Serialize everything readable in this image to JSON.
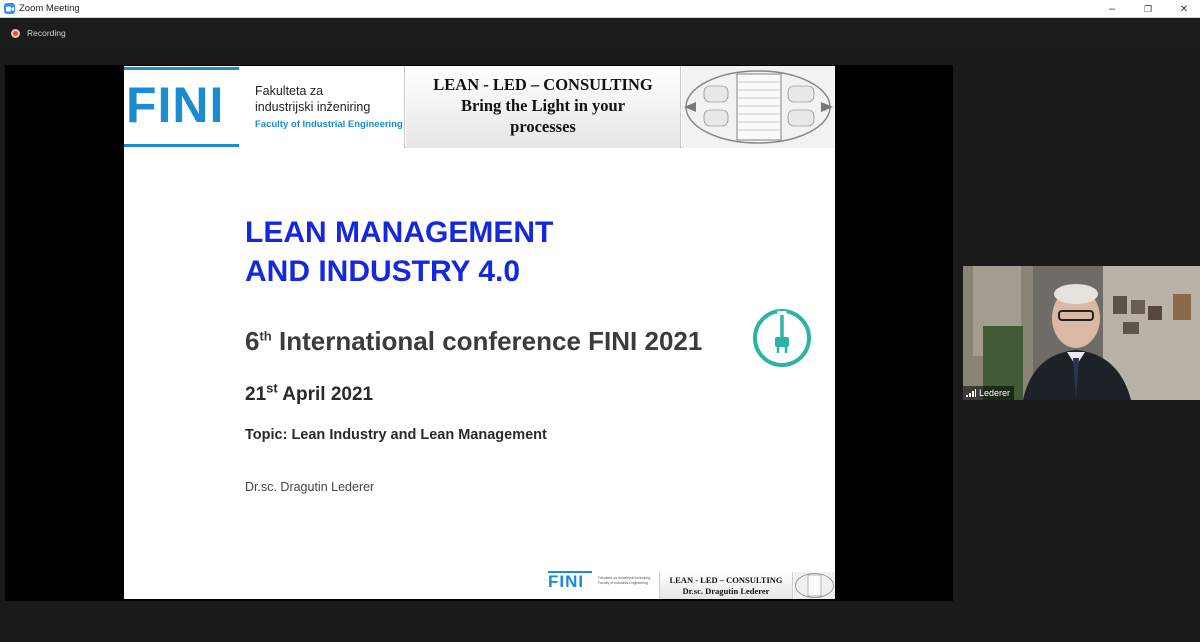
{
  "window": {
    "title": "Zoom Meeting",
    "minimize_glyph": "–",
    "maximize_glyph": "❐",
    "close_glyph": "✕"
  },
  "recording": {
    "label": "Recording"
  },
  "slide": {
    "header": {
      "logo": "FINI",
      "faculty_line1": "Fakulteta za",
      "faculty_line2": "industrijski inženiring",
      "faculty_line3": "Faculty of Industrial Engineering",
      "consult_line1": "LEAN - LED – CONSULTING",
      "consult_line2": "Bring the Light in your",
      "consult_line3": "processes"
    },
    "title_line1": "LEAN MANAGEMENT",
    "title_line2": "AND INDUSTRY 4.0",
    "conference_number": "6",
    "conference_sup": "th",
    "conference_text": " International conference FINI 2021",
    "date_day": "21",
    "date_sup": "st",
    "date_rest": " April 2021",
    "topic": "Topic: Lean Industry and Lean Management",
    "author": "Dr.sc. Dragutin Lederer",
    "footer": {
      "logo": "FINI",
      "faculty": "Fakulteta za industrijski inženiring Faculty of Industrial Engineering",
      "consult_line1": "LEAN - LED – CONSULTING",
      "consult_line2": "Dr.sc. Dragutin Lederer"
    }
  },
  "participant": {
    "name": "Lederer"
  },
  "colors": {
    "zoom_blue": "#2d8cff",
    "fini_blue": "#1a8ccf",
    "title_blue": "#1428dc",
    "power_teal": "#2bb3a3",
    "recording_red": "#d9534f"
  }
}
